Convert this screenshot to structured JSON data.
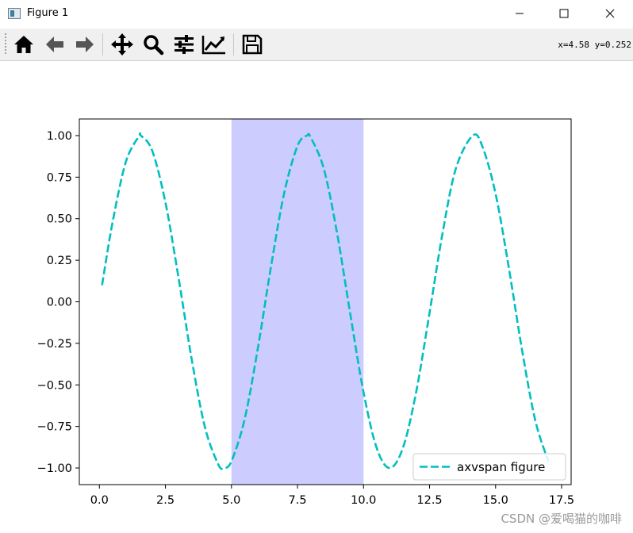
{
  "window": {
    "title": "Figure 1",
    "icon": "figure-window-icon"
  },
  "toolbar": {
    "buttons": [
      {
        "name": "home",
        "icon": "home-icon"
      },
      {
        "name": "back",
        "icon": "arrow-left-icon"
      },
      {
        "name": "forward",
        "icon": "arrow-right-icon"
      },
      {
        "name": "pan",
        "icon": "move-icon"
      },
      {
        "name": "zoom",
        "icon": "magnifier-icon"
      },
      {
        "name": "subplots",
        "icon": "sliders-icon"
      },
      {
        "name": "edit",
        "icon": "line-chart-icon"
      },
      {
        "name": "save",
        "icon": "floppy-disk-icon"
      }
    ],
    "coordinates": "x=4.58  y=0.252"
  },
  "watermark": "CSDN @爱喝猫的咖啡",
  "colors": {
    "line": "#00bfbf",
    "span": "#ccccff",
    "axes": "#000000"
  },
  "chart_data": {
    "type": "line",
    "title": "",
    "xlabel": "",
    "ylabel": "",
    "xlim": [
      -0.76,
      17.86
    ],
    "ylim": [
      -1.1,
      1.1
    ],
    "xticks": [
      0.0,
      2.5,
      5.0,
      7.5,
      10.0,
      12.5,
      15.0,
      17.5
    ],
    "xtick_labels": [
      "0.0",
      "2.5",
      "5.0",
      "7.5",
      "10.0",
      "12.5",
      "15.0",
      "17.5"
    ],
    "yticks": [
      1.0,
      0.75,
      0.5,
      0.25,
      0.0,
      -0.25,
      -0.5,
      -0.75,
      -1.0
    ],
    "ytick_labels": [
      "1.00",
      "0.75",
      "0.50",
      "0.25",
      "0.00",
      "−0.25",
      "−0.50",
      "−0.75",
      "−1.00"
    ],
    "grid": false,
    "legend": {
      "position": "lower-right"
    },
    "axvspan": {
      "xmin": 5.0,
      "xmax": 10.0,
      "color": "#ccccff"
    },
    "series": [
      {
        "name": "axvspan figure",
        "style": "dashed",
        "color": "#00bfbf",
        "x": [
          0.1,
          0.5,
          1.0,
          1.5,
          1.571,
          2.0,
          2.5,
          3.0,
          3.5,
          4.0,
          4.5,
          4.712,
          5.0,
          5.5,
          6.0,
          6.5,
          7.0,
          7.5,
          7.854,
          8.0,
          8.5,
          9.0,
          9.5,
          10.0,
          10.5,
          10.996,
          11.5,
          12.0,
          12.5,
          13.0,
          13.5,
          14.137,
          14.5,
          15.0,
          15.5,
          16.0,
          16.5,
          17.0
        ],
        "y": [
          0.1,
          0.479,
          0.841,
          0.997,
          1.0,
          0.909,
          0.598,
          0.141,
          -0.351,
          -0.757,
          -0.978,
          -1.0,
          -0.959,
          -0.706,
          -0.279,
          0.215,
          0.657,
          0.938,
          1.0,
          0.989,
          0.798,
          0.412,
          -0.075,
          -0.544,
          -0.88,
          -1.0,
          -0.875,
          -0.537,
          -0.066,
          0.42,
          0.804,
          1.0,
          0.935,
          0.65,
          0.206,
          -0.288,
          -0.712,
          -0.961
        ]
      }
    ]
  }
}
